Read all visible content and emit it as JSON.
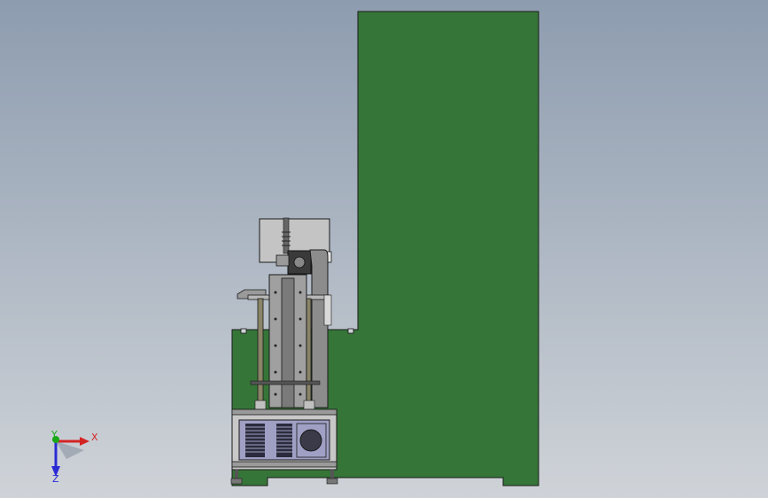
{
  "viewport": {
    "background_top": "#8d9caf",
    "background_bottom": "#cfd3d8"
  },
  "model": {
    "frame_color": "#367538",
    "outline_color": "#1a1a1a",
    "metal_color": "#8c8c8c",
    "dark_metal_color": "#555555",
    "panel_color": "#9fa0c4",
    "cabinet_color": "#c8c8c8"
  },
  "triad": {
    "x_label": "X",
    "y_label": "Y",
    "z_label": "Z",
    "x_color": "#d42424",
    "y_color": "#18a818",
    "z_color": "#2b2bd4"
  }
}
